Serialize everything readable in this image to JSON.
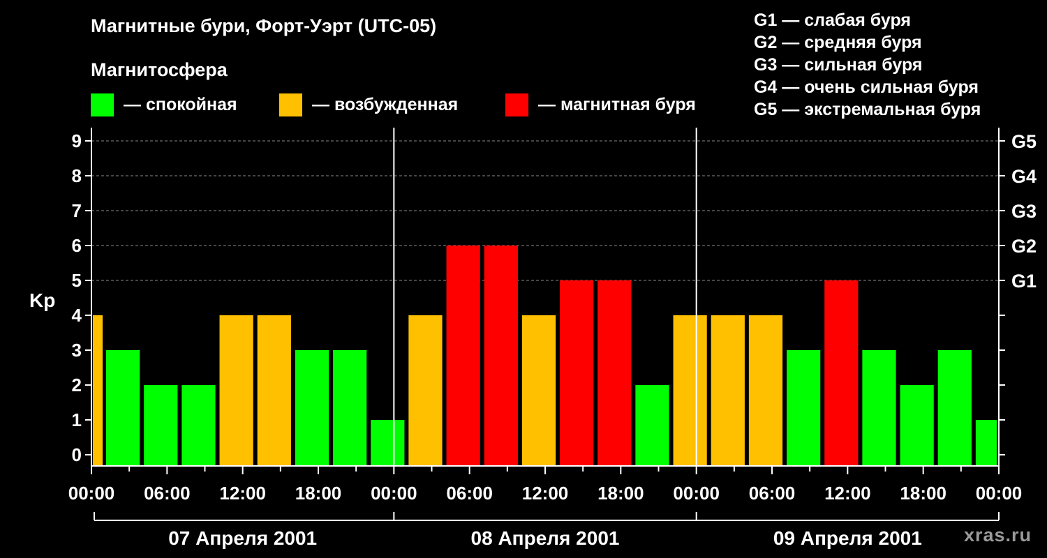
{
  "header": {
    "title": "Магнитные бури, Форт-Уэрт (UTC-05)",
    "subtitle": "Магнитосфера"
  },
  "legend": [
    {
      "label": "— спокойная",
      "color": "#00ff00"
    },
    {
      "label": "— возбужденная",
      "color": "#ffc000"
    },
    {
      "label": "— магнитная буря",
      "color": "#ff0000"
    }
  ],
  "storm_scale": [
    "G1 — слабая буря",
    "G2 — средняя буря",
    "G3 — сильная буря",
    "G4 — очень сильная буря",
    "G5 — экстремальная буря"
  ],
  "watermark": "xras.ru",
  "chart_data": {
    "type": "bar",
    "ylabel": "Kp",
    "ylim": [
      0,
      9
    ],
    "yticks": [
      0,
      1,
      2,
      3,
      4,
      5,
      6,
      7,
      8,
      9
    ],
    "right_axis_labels": [
      {
        "kp": 5,
        "label": "G1"
      },
      {
        "kp": 6,
        "label": "G2"
      },
      {
        "kp": 7,
        "label": "G3"
      },
      {
        "kp": 8,
        "label": "G4"
      },
      {
        "kp": 9,
        "label": "G5"
      }
    ],
    "grid": "horizontal-dashed",
    "x_tick_labels": [
      "00:00",
      "06:00",
      "12:00",
      "18:00",
      "00:00",
      "06:00",
      "12:00",
      "18:00",
      "00:00",
      "06:00",
      "12:00",
      "18:00",
      "00:00"
    ],
    "days": [
      "07 Апреля 2001",
      "08 Апреля 2001",
      "09 Апреля 2001"
    ],
    "colors": {
      "quiet": "#00ff00",
      "active": "#ffc000",
      "storm": "#ff0000"
    },
    "bars": [
      {
        "day": "07 Апреля 2001",
        "start": "00:00",
        "end": "01:00",
        "kp": 4,
        "status": "active"
      },
      {
        "day": "07 Апреля 2001",
        "start": "01:00",
        "end": "04:00",
        "kp": 3,
        "status": "quiet"
      },
      {
        "day": "07 Апреля 2001",
        "start": "04:00",
        "end": "07:00",
        "kp": 2,
        "status": "quiet"
      },
      {
        "day": "07 Апреля 2001",
        "start": "07:00",
        "end": "10:00",
        "kp": 2,
        "status": "quiet"
      },
      {
        "day": "07 Апреля 2001",
        "start": "10:00",
        "end": "13:00",
        "kp": 4,
        "status": "active"
      },
      {
        "day": "07 Апреля 2001",
        "start": "13:00",
        "end": "16:00",
        "kp": 4,
        "status": "active"
      },
      {
        "day": "07 Апреля 2001",
        "start": "16:00",
        "end": "19:00",
        "kp": 3,
        "status": "quiet"
      },
      {
        "day": "07 Апреля 2001",
        "start": "19:00",
        "end": "22:00",
        "kp": 3,
        "status": "quiet"
      },
      {
        "day": "07 Апреля 2001",
        "start": "22:00",
        "end": "01:00",
        "kp": 1,
        "status": "quiet"
      },
      {
        "day": "08 Апреля 2001",
        "start": "01:00",
        "end": "04:00",
        "kp": 4,
        "status": "active"
      },
      {
        "day": "08 Апреля 2001",
        "start": "04:00",
        "end": "07:00",
        "kp": 6,
        "status": "storm"
      },
      {
        "day": "08 Апреля 2001",
        "start": "07:00",
        "end": "10:00",
        "kp": 6,
        "status": "storm"
      },
      {
        "day": "08 Апреля 2001",
        "start": "10:00",
        "end": "13:00",
        "kp": 4,
        "status": "active"
      },
      {
        "day": "08 Апреля 2001",
        "start": "13:00",
        "end": "16:00",
        "kp": 5,
        "status": "storm"
      },
      {
        "day": "08 Апреля 2001",
        "start": "16:00",
        "end": "19:00",
        "kp": 5,
        "status": "storm"
      },
      {
        "day": "08 Апреля 2001",
        "start": "19:00",
        "end": "22:00",
        "kp": 2,
        "status": "quiet"
      },
      {
        "day": "08 Апреля 2001",
        "start": "22:00",
        "end": "01:00",
        "kp": 4,
        "status": "active"
      },
      {
        "day": "09 Апреля 2001",
        "start": "01:00",
        "end": "04:00",
        "kp": 4,
        "status": "active"
      },
      {
        "day": "09 Апреля 2001",
        "start": "04:00",
        "end": "07:00",
        "kp": 4,
        "status": "active"
      },
      {
        "day": "09 Апреля 2001",
        "start": "07:00",
        "end": "10:00",
        "kp": 3,
        "status": "quiet"
      },
      {
        "day": "09 Апреля 2001",
        "start": "10:00",
        "end": "13:00",
        "kp": 5,
        "status": "storm"
      },
      {
        "day": "09 Апреля 2001",
        "start": "13:00",
        "end": "16:00",
        "kp": 3,
        "status": "quiet"
      },
      {
        "day": "09 Апреля 2001",
        "start": "16:00",
        "end": "19:00",
        "kp": 2,
        "status": "quiet"
      },
      {
        "day": "09 Апреля 2001",
        "start": "19:00",
        "end": "22:00",
        "kp": 3,
        "status": "quiet"
      },
      {
        "day": "09 Апреля 2001",
        "start": "22:00",
        "end": "24:00",
        "kp": 1,
        "status": "quiet"
      }
    ]
  }
}
